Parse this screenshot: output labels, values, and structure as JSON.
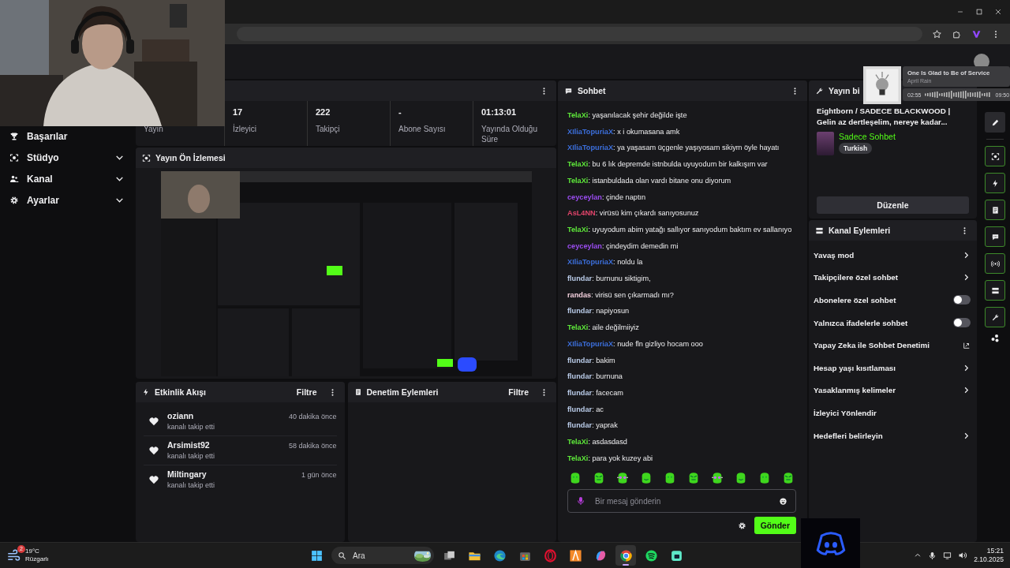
{
  "sidebar": {
    "items": [
      {
        "label": "Başarılar",
        "has_submenu": false
      },
      {
        "label": "Stüdyo",
        "has_submenu": true
      },
      {
        "label": "Kanal",
        "has_submenu": true
      },
      {
        "label": "Ayarlar",
        "has_submenu": true
      }
    ]
  },
  "stats": {
    "items": [
      {
        "label": "Yayın"
      },
      {
        "value": "17",
        "label": "İzleyici"
      },
      {
        "value": "222",
        "label": "Takipçi"
      },
      {
        "value": "-",
        "label": "Abone Sayısı"
      },
      {
        "value": "01:13:01",
        "label": "Yayında Olduğu Süre"
      }
    ]
  },
  "preview": {
    "title": "Yayın Ön İzlemesi"
  },
  "activity": {
    "title": "Etkinlik Akışı",
    "filter": "Filtre",
    "events": [
      {
        "user": "oziann",
        "action": "kanalı takip etti",
        "time": "40 dakika önce"
      },
      {
        "user": "Arsimist92",
        "action": "kanalı takip etti",
        "time": "58 dakika önce"
      },
      {
        "user": "Miltingary",
        "action": "kanalı takip etti",
        "time": "1 gün önce"
      }
    ]
  },
  "moderation": {
    "title": "Denetim Eylemleri",
    "filter": "Filtre"
  },
  "chat": {
    "title": "Sohbet",
    "messages": [
      {
        "user": "TelaXi",
        "color": "#5ee83a",
        "text": ": yaşanılacak şehir değilde işte"
      },
      {
        "user": "XIliaTopuriaX",
        "color": "#3c6fdc",
        "text": ": x i okumasana amk"
      },
      {
        "user": "XIliaTopuriaX",
        "color": "#3c6fdc",
        "text": ": ya yaşasam üçgenle yaşıyosam sikiym öyle hayatı"
      },
      {
        "user": "TelaXi",
        "color": "#5ee83a",
        "text": ": bu 6 lık depremde istnbulda uyuyodum bir kalkışım var"
      },
      {
        "user": "TelaXi",
        "color": "#5ee83a",
        "text": ": istanbuldada olan vardı bitane onu diyorum"
      },
      {
        "user": "ceyceylan",
        "color": "#9a4cf0",
        "text": ": çinde naptın"
      },
      {
        "user": "AsL4NN",
        "color": "#e0446a",
        "text": ": virüsü kim çıkardı sanıyosunuz"
      },
      {
        "user": "TelaXi",
        "color": "#5ee83a",
        "text": ": uyuyodum abim yatağı sallıyor sanıyodum baktım ev sallanıyo"
      },
      {
        "user": "ceyceylan",
        "color": "#9a4cf0",
        "text": ": çindeydim demedin mi"
      },
      {
        "user": "XIliaTopuriaX",
        "color": "#3c6fdc",
        "text": ": noldu la"
      },
      {
        "user": "flundar",
        "color": "#b9cbe8",
        "text": ": burnunu siktigim,"
      },
      {
        "user": "randas",
        "color": "#f2cfdc",
        "text": ": virisü sen çıkarmadı mı?"
      },
      {
        "user": "flundar",
        "color": "#b9cbe8",
        "text": ": napiyosun"
      },
      {
        "user": "TelaXi",
        "color": "#5ee83a",
        "text": ": aile değilmiiyiz"
      },
      {
        "user": "XIliaTopuriaX",
        "color": "#3c6fdc",
        "text": ": nude fln gizliyo hocam ooo"
      },
      {
        "user": "flundar",
        "color": "#b9cbe8",
        "text": ": bakim"
      },
      {
        "user": "flundar",
        "color": "#b9cbe8",
        "text": ": burnuna"
      },
      {
        "user": "flundar",
        "color": "#b9cbe8",
        "text": ": facecam"
      },
      {
        "user": "flundar",
        "color": "#b9cbe8",
        "text": ": ac"
      },
      {
        "user": "flundar",
        "color": "#b9cbe8",
        "text": ": yaprak"
      },
      {
        "user": "TelaXi",
        "color": "#5ee83a",
        "text": ": asdasdasd"
      },
      {
        "user": "TelaXi",
        "color": "#5ee83a",
        "text": ": para yok kuzey abi"
      }
    ],
    "input": {
      "placeholder": "Bir mesaj gönderin"
    },
    "send": "Gönder"
  },
  "stream_info": {
    "title": "Yayın bi",
    "stream_title": "Eightborn / SADECE BLACKWOOD | Gelin az dertleşelim, nereye kadar...",
    "category": "Sadece Sohbet",
    "tags": [
      "Turkish"
    ],
    "edit": "Düzenle"
  },
  "channel_actions": {
    "title": "Kanal Eylemleri",
    "items": [
      {
        "kind": "submenu",
        "label": "Yavaş mod"
      },
      {
        "kind": "submenu",
        "label": "Takipçilere özel sohbet"
      },
      {
        "kind": "toggle",
        "label": "Abonelere özel sohbet",
        "on": false
      },
      {
        "kind": "toggle",
        "label": "Yalnızca ifadelerle sohbet",
        "on": false
      },
      {
        "kind": "external",
        "label": "Yapay Zeka ile Sohbet Denetimi"
      },
      {
        "kind": "submenu",
        "label": "Hesap yaşı kısıtlaması"
      },
      {
        "kind": "submenu",
        "label": "Yasaklanmış kelimeler"
      },
      {
        "kind": "plain",
        "label": "İzleyici Yönlendir"
      },
      {
        "kind": "submenu",
        "label": "Hedefleri belirleyin"
      }
    ]
  },
  "music": {
    "title": "One Is Glad to Be of Service",
    "artist": "April Rain",
    "elapsed": "02:55",
    "duration": "09:50"
  },
  "taskbar": {
    "weather": {
      "badge": "2",
      "temp": "19°C",
      "condition": "Rüzgarlı"
    },
    "search": {
      "placeholder": "Ara"
    },
    "apps": [
      {
        "kind": "taskview",
        "selected": false
      },
      {
        "kind": "folder",
        "selected": false
      },
      {
        "kind": "edge",
        "selected": false
      },
      {
        "kind": "store",
        "selected": false
      },
      {
        "kind": "opera",
        "selected": false
      },
      {
        "kind": "triangle",
        "selected": false
      },
      {
        "kind": "copilot",
        "selected": false
      },
      {
        "kind": "chrome",
        "selected": true
      },
      {
        "kind": "spotify",
        "selected": false
      },
      {
        "kind": "streamer",
        "selected": false
      }
    ],
    "clock": {
      "time": "15:21",
      "date": "2.10.2025"
    }
  }
}
